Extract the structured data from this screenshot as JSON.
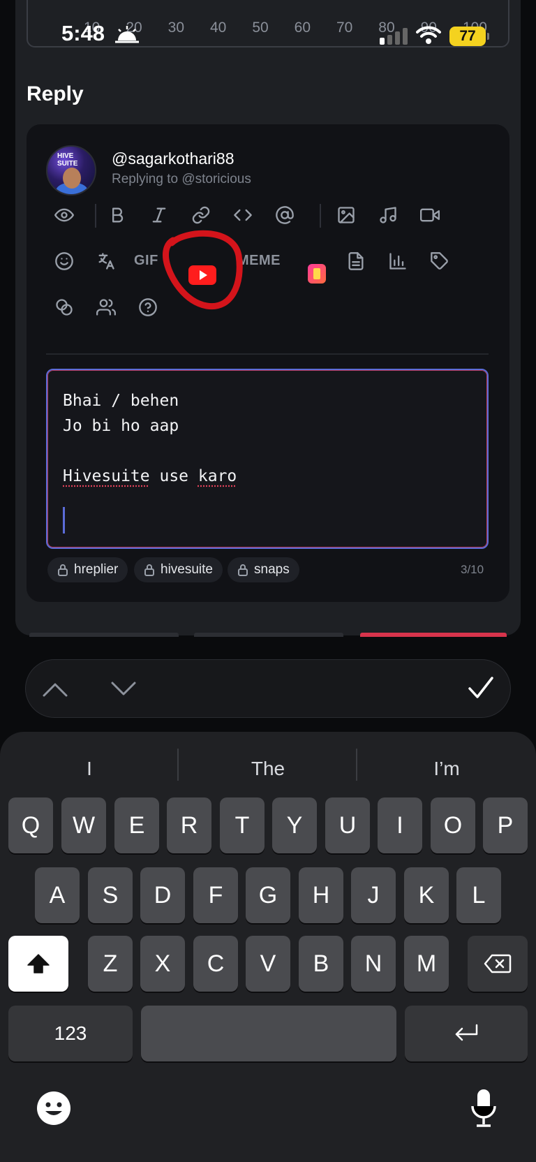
{
  "status_bar": {
    "time": "5:48",
    "battery": "77",
    "sunrise_icon": "sunrise-icon",
    "wifi_icon": "wifi-icon",
    "signal_icon": "signal-icon"
  },
  "slider": {
    "scale": [
      "10",
      "20",
      "30",
      "40",
      "50",
      "60",
      "70",
      "80",
      "90",
      "100"
    ]
  },
  "reply": {
    "title": "Reply",
    "username": "@sagarkothari88",
    "replying_to": "Replying to @storicious",
    "avatar_text": "HIVE SUITE"
  },
  "toolbar": {
    "row1": [
      "eye-icon",
      "bold-icon",
      "italic-icon",
      "link-icon",
      "code-icon",
      "mention-icon",
      "image-icon",
      "music-icon",
      "video-icon"
    ],
    "row2": [
      "emoji-icon",
      "translate-icon",
      "gif",
      "youtube-icon",
      "meme",
      "snaps-icon",
      "document-icon",
      "poll-icon",
      "tag-icon"
    ],
    "row3": [
      "coins-icon",
      "users-icon",
      "help-icon"
    ],
    "gif_label": "GIF",
    "meme_label": "MEME"
  },
  "editor": {
    "lines": [
      "Bhai / behen",
      "Jo bi ho aap",
      "",
      "Hivesuite use karo"
    ],
    "line1": "Bhai / behen",
    "line2": "Jo bi ho aap",
    "line4_word1": "Hivesuite",
    "line4_word2": " use ",
    "line4_word3": "karo",
    "accent_color": "#5b6cd8"
  },
  "tags": {
    "items": [
      "hreplier",
      "hivesuite",
      "snaps"
    ],
    "count": "3/10"
  },
  "annotation": {
    "color": "#d4141b"
  },
  "keyboard": {
    "suggestions": [
      "I",
      "The",
      "I’m"
    ],
    "row1": [
      "Q",
      "W",
      "E",
      "R",
      "T",
      "Y",
      "U",
      "I",
      "O",
      "P"
    ],
    "row2": [
      "A",
      "S",
      "D",
      "F",
      "G",
      "H",
      "J",
      "K",
      "L"
    ],
    "row3": [
      "Z",
      "X",
      "C",
      "V",
      "B",
      "N",
      "M"
    ],
    "numbers_label": "123"
  }
}
